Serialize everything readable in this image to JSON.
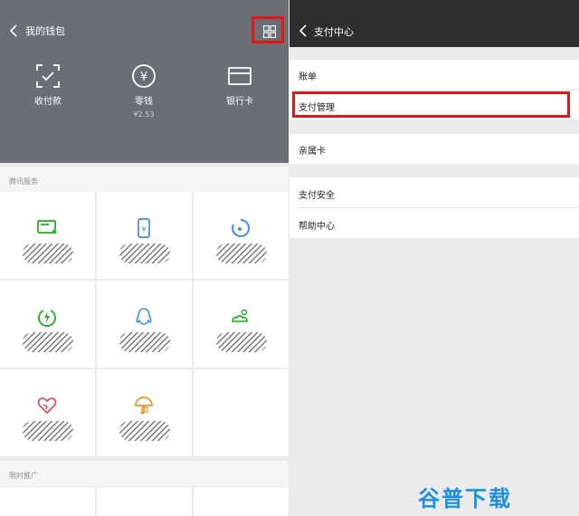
{
  "wallet": {
    "title": "我的钱包",
    "items": [
      {
        "label": "收付款",
        "sub": ""
      },
      {
        "label": "零钱",
        "sub": "¥2.53"
      },
      {
        "label": "银行卡",
        "sub": ""
      }
    ],
    "sections": {
      "tencent_services": "腾讯服务",
      "limited_promo": "限时推广"
    }
  },
  "payment_center": {
    "title": "支付中心",
    "groups": [
      [
        "账单",
        "支付管理"
      ],
      [
        "亲属卡"
      ],
      [
        "支付安全",
        "帮助中心"
      ]
    ]
  },
  "watermark": "谷普下载",
  "colors": {
    "wallet_header": "#6c6e75",
    "nav_dark": "#2e2e2e",
    "highlight": "#e01717",
    "green": "#1aad19",
    "blue": "#3b8fe0",
    "red": "#e24a5a",
    "orange": "#f0951f"
  }
}
